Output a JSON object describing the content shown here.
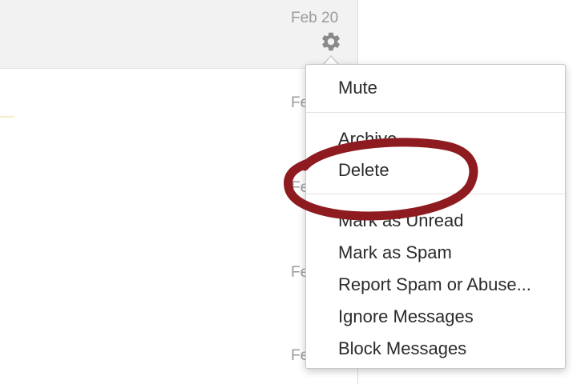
{
  "conversation_list": {
    "rows": [
      {
        "date": "Feb 20",
        "selected": true
      },
      {
        "date": "Fe"
      },
      {
        "date": "Fe"
      },
      {
        "date": "Fe"
      },
      {
        "date": "Fe"
      }
    ]
  },
  "settings_icon": "gear-icon",
  "menu": {
    "groups": [
      {
        "items": [
          "Mute"
        ]
      },
      {
        "items": [
          "Archive",
          "Delete"
        ]
      },
      {
        "items": [
          "Mark as Unread",
          "Mark as Spam",
          "Report Spam or Abuse...",
          "Ignore Messages",
          "Block Messages"
        ]
      }
    ]
  },
  "colors": {
    "annotation": "#8e1b1f",
    "selected_row": "#f2f2f2",
    "date_text": "#9a9a9a",
    "gear": "#8a8a8a",
    "menu_text": "#2b2b2b"
  }
}
